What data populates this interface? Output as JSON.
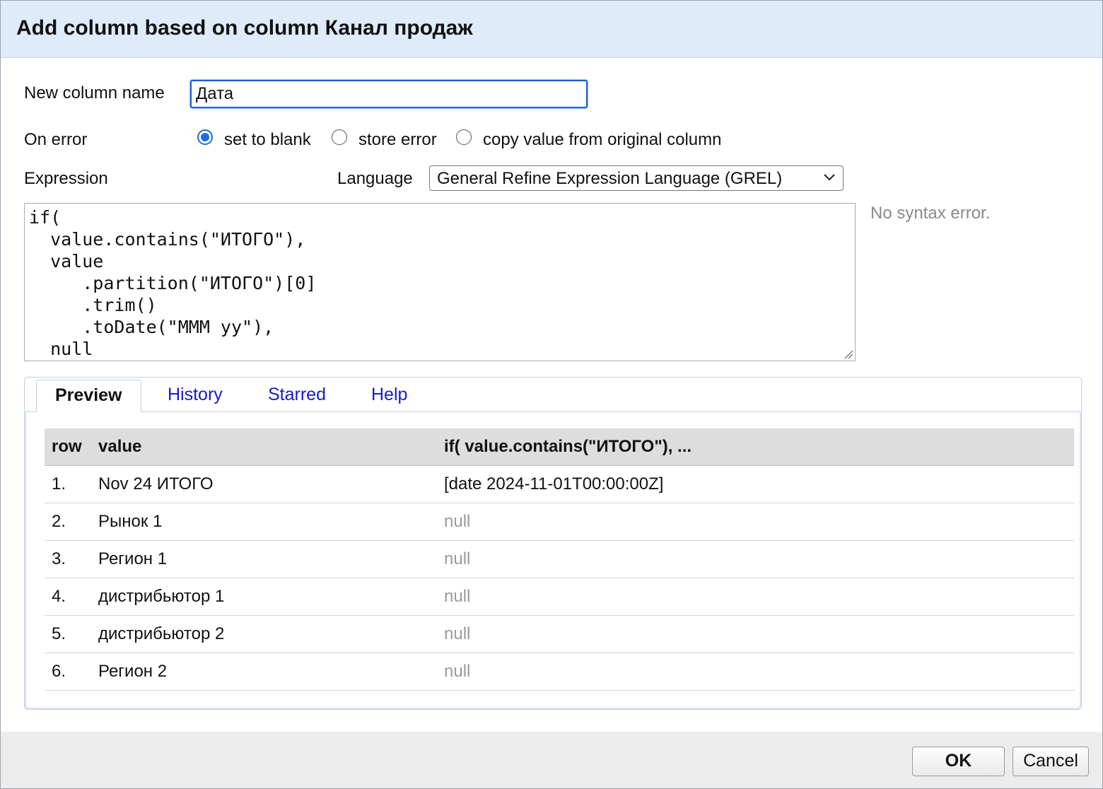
{
  "dialog": {
    "title": "Add column based on column Канал продаж"
  },
  "form": {
    "new_column_name_label": "New column name",
    "new_column_name_value": "Дата",
    "on_error_label": "On error",
    "on_error_options": [
      {
        "label": "set to blank",
        "checked": true
      },
      {
        "label": "store error",
        "checked": false
      },
      {
        "label": "copy value from original column",
        "checked": false
      }
    ],
    "expression_label": "Expression",
    "language_label": "Language",
    "language_selected": "General Refine Expression Language (GREL)",
    "expression_code": "if(\n  value.contains(\"ИТОГО\"),\n  value\n     .partition(\"ИТОГО\")[0]\n     .trim()\n     .toDate(\"MMM yy\"),\n  null",
    "syntax_status": "No syntax error."
  },
  "tabs": [
    {
      "label": "Preview",
      "active": true
    },
    {
      "label": "History",
      "active": false
    },
    {
      "label": "Starred",
      "active": false
    },
    {
      "label": "Help",
      "active": false
    }
  ],
  "preview_table": {
    "headers": [
      "row",
      "value",
      "if( value.contains(\"ИТОГО\"), ..."
    ],
    "rows": [
      {
        "row": "1.",
        "value": "Nov 24 ИТОГО",
        "result": "[date 2024-11-01T00:00:00Z]",
        "is_null": false
      },
      {
        "row": "2.",
        "value": "Рынок 1",
        "result": "null",
        "is_null": true
      },
      {
        "row": "3.",
        "value": "Регион 1",
        "result": "null",
        "is_null": true
      },
      {
        "row": "4.",
        "value": "дистрибьютор 1",
        "result": "null",
        "is_null": true
      },
      {
        "row": "5.",
        "value": "дистрибьютор 2",
        "result": "null",
        "is_null": true
      },
      {
        "row": "6.",
        "value": "Регион 2",
        "result": "null",
        "is_null": true
      }
    ]
  },
  "buttons": {
    "ok_label": "OK",
    "cancel_label": "Cancel"
  },
  "colors": {
    "title_bar_bg": "#deebfb",
    "link_blue": "#1a1ad0",
    "radio_accent": "#1a6fe0",
    "null_gray": "#9a9a9a"
  }
}
